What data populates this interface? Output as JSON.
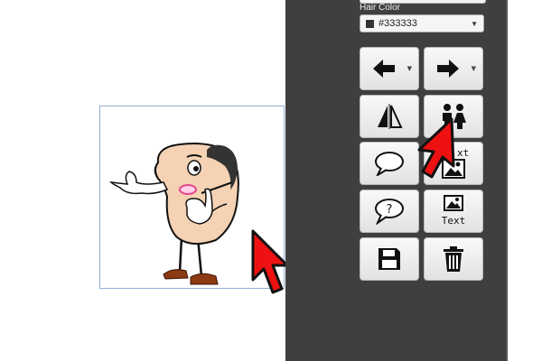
{
  "controls": {
    "hair_color": {
      "label": "Hair Color",
      "value": "#333333",
      "swatch": "#333333"
    }
  },
  "toolbar": {
    "buttons": [
      {
        "name": "undo-button",
        "icon": "arrow-left-icon",
        "has_dropdown": true
      },
      {
        "name": "redo-button",
        "icon": "arrow-right-icon",
        "has_dropdown": true
      },
      {
        "name": "flip-button",
        "icon": "flip-horizontal-icon"
      },
      {
        "name": "add-character-button",
        "icon": "people-icon"
      },
      {
        "name": "speech-bubble-button",
        "icon": "speech-bubble-icon"
      },
      {
        "name": "add-image-button",
        "icon": "image-icon"
      },
      {
        "name": "question-bubble-button",
        "icon": "question-bubble-icon"
      },
      {
        "name": "image-text-button",
        "icon": "image-text-icon",
        "label": "Text"
      },
      {
        "name": "save-button",
        "icon": "floppy-disk-icon"
      },
      {
        "name": "delete-button",
        "icon": "trash-icon"
      }
    ],
    "hidden_label": "xt"
  },
  "colors": {
    "panel": "#3f3f3f",
    "button_face": "#efefef",
    "cursor": "#ee1111",
    "canvas_border": "#8fb0d6"
  }
}
